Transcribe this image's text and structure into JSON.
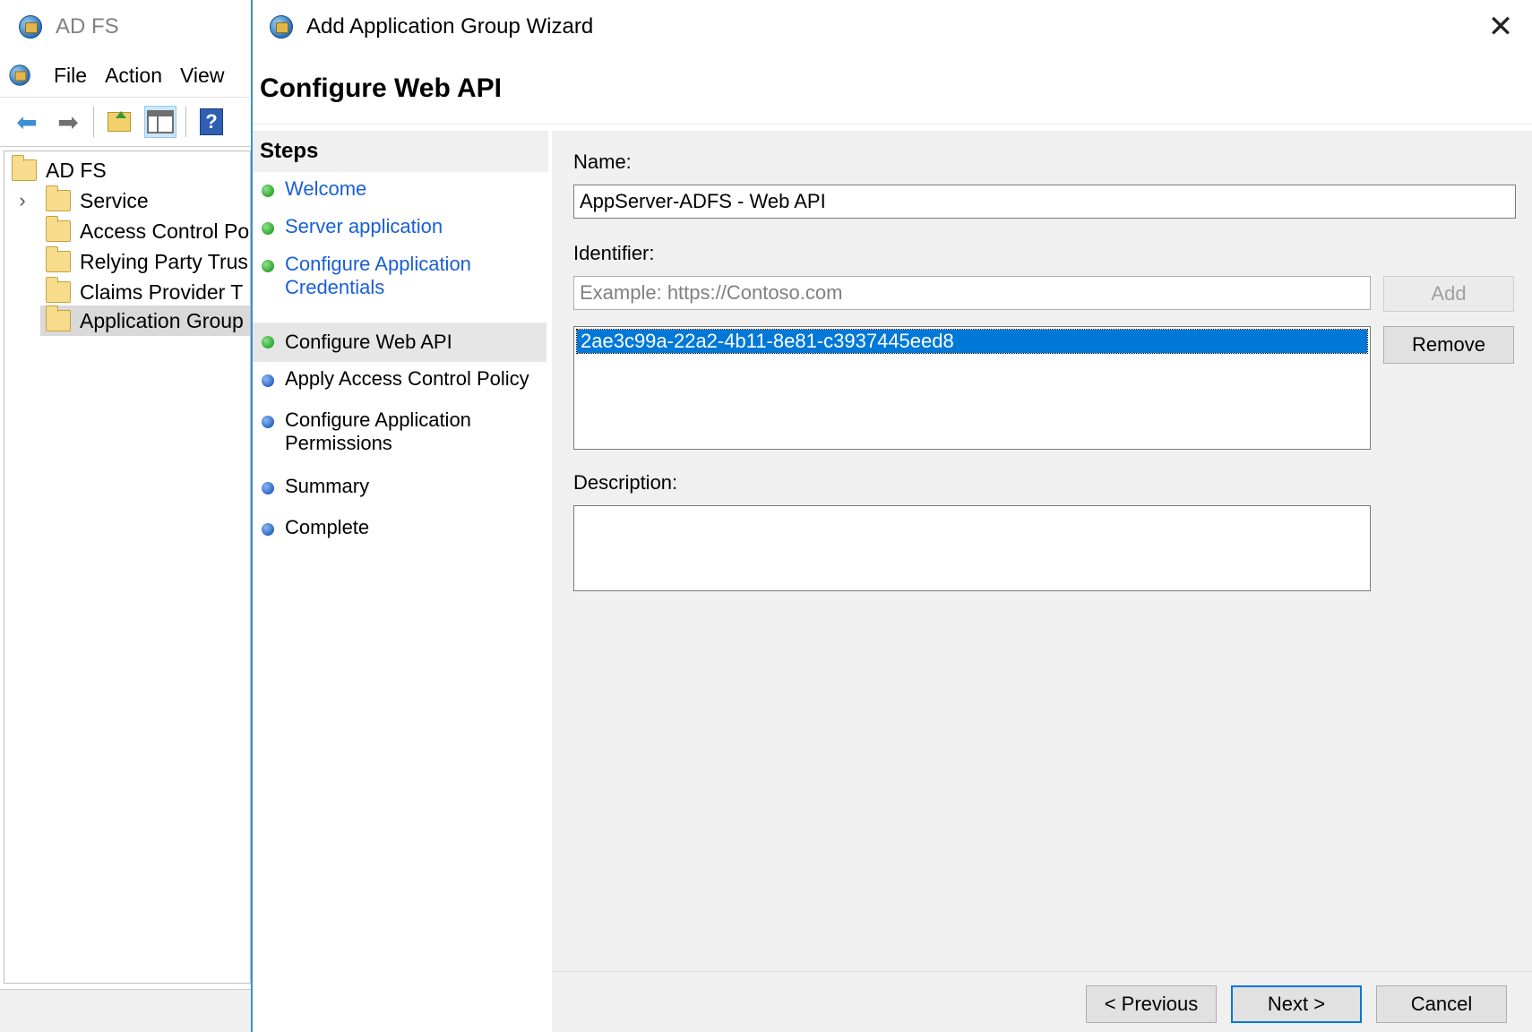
{
  "mmc": {
    "title": "AD FS",
    "menu": [
      "File",
      "Action",
      "View"
    ],
    "tree": [
      {
        "label": "AD FS",
        "level": 0,
        "expandable": false,
        "selected": false
      },
      {
        "label": "Service",
        "level": 1,
        "expandable": true,
        "selected": false
      },
      {
        "label": "Access Control Po",
        "level": 1,
        "expandable": false,
        "selected": false
      },
      {
        "label": "Relying Party Trus",
        "level": 1,
        "expandable": false,
        "selected": false
      },
      {
        "label": "Claims Provider T",
        "level": 1,
        "expandable": false,
        "selected": false
      },
      {
        "label": "Application Group",
        "level": 1,
        "expandable": false,
        "selected": true
      }
    ]
  },
  "wizard": {
    "title": "Add Application Group Wizard",
    "page_title": "Configure Web API",
    "close_icon": "close-icon",
    "steps_header": "Steps",
    "steps": [
      {
        "label": "Welcome",
        "state": "done"
      },
      {
        "label": "Server application",
        "state": "done"
      },
      {
        "label": "Configure Application Credentials",
        "state": "done"
      },
      {
        "label": "Configure Web API",
        "state": "current"
      },
      {
        "label": "Apply Access Control Policy",
        "state": "pending"
      },
      {
        "label": "Configure Application Permissions",
        "state": "pending"
      },
      {
        "label": "Summary",
        "state": "pending"
      },
      {
        "label": "Complete",
        "state": "pending"
      }
    ],
    "form": {
      "name_label": "Name:",
      "name_value": "AppServer-ADFS - Web API",
      "identifier_label": "Identifier:",
      "identifier_placeholder": "Example: https://Contoso.com",
      "add_label": "Add",
      "remove_label": "Remove",
      "identifiers": [
        "2ae3c99a-22a2-4b11-8e81-c3937445eed8"
      ],
      "description_label": "Description:",
      "description_value": ""
    },
    "buttons": {
      "previous": "< Previous",
      "next": "Next >",
      "cancel": "Cancel"
    },
    "colors": {
      "link_blue": "#1a5fd6",
      "selection_blue": "#0078d7",
      "done_dot": "#2fa82f",
      "pending_dot": "#2e66c9"
    }
  }
}
